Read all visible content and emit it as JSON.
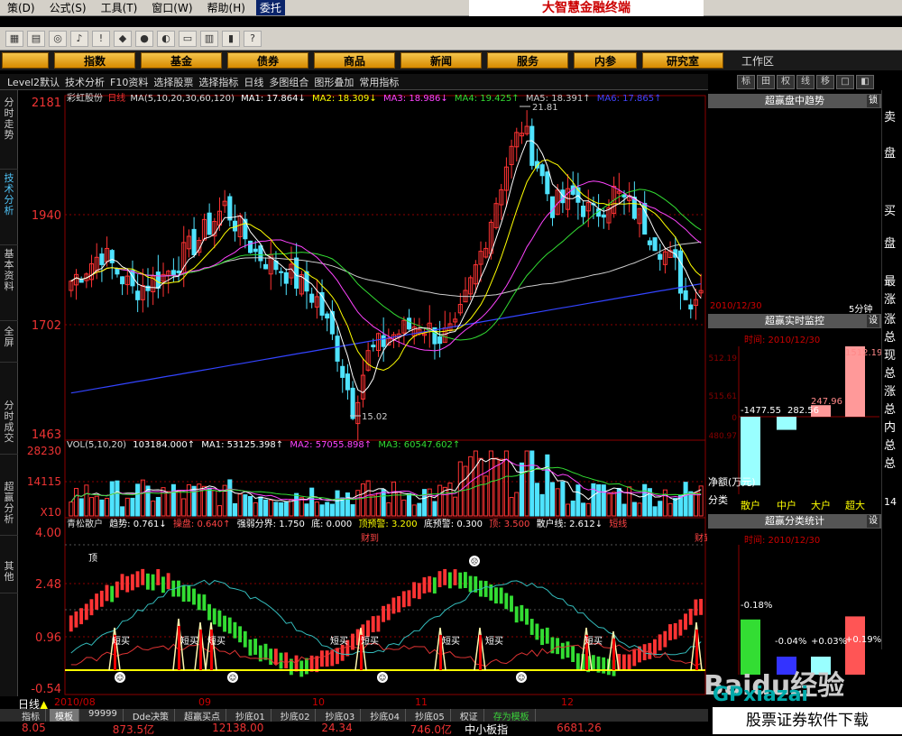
{
  "menu": {
    "items": [
      "策(D)",
      "公式(S)",
      "工具(T)",
      "窗口(W)",
      "帮助(H)"
    ],
    "trade": "委托"
  },
  "brand": "大智慧金融终端",
  "nav": {
    "buttons": [
      "指数",
      "基金",
      "债券",
      "商品",
      "新闻",
      "服务",
      "内参",
      "研究室"
    ],
    "workarea": "工作区"
  },
  "tabrow": [
    "Level2默认",
    "技术分析",
    "F10资料",
    "选择股票",
    "选择指标",
    "日线",
    "多图组合",
    "图形叠加",
    "常用指标"
  ],
  "right_tools": [
    "标",
    "田",
    "权",
    "线",
    "移",
    "□",
    "◧"
  ],
  "left_tabs": [
    "分时走势",
    "技术分析",
    "基本资料",
    "全屏",
    "分时成交",
    "超赢分析",
    "其他"
  ],
  "price_panel": {
    "stock_name": "彩虹股份",
    "period": "日线",
    "ma_label": "MA(5,10,20,30,60,120)",
    "ma_values": [
      "MA1: 17.864↓",
      "MA2: 18.309↓",
      "MA3: 18.986↓",
      "MA4: 19.425↑",
      "MA5: 18.391↑",
      "MA6: 17.865↑"
    ],
    "y_ticks": [
      "2181",
      "1940",
      "1702",
      "1463"
    ],
    "high_label": "21.81",
    "low_label": "15.02"
  },
  "vol_panel": {
    "label": "VOL(5,10,20)",
    "values": [
      "103184.000↑",
      "MA1: 53125.398↑",
      "MA2: 57055.898↑",
      "MA3: 60547.602↑"
    ],
    "y_ticks": [
      "28230",
      "14115",
      "X10"
    ]
  },
  "indicator_panel": {
    "title": "青松散户",
    "values": [
      "趋势: 0.761↓",
      "操盘: 0.640↑",
      "强弱分界: 1.750",
      "底: 0.000",
      "顶预警: 3.200",
      "底预警: 0.300",
      "顶: 3.500",
      "散户线: 2.612↓",
      "短线"
    ],
    "y_ticks": [
      "4.00",
      "2.48",
      "0.96",
      "-0.54"
    ],
    "signal_labels": [
      "顶",
      "短买",
      "短买",
      "短买",
      "短买",
      "短买",
      "短买",
      "短买",
      "短买",
      "财到",
      "财到"
    ]
  },
  "dates": [
    "2010/08",
    "09",
    "10",
    "11",
    "12"
  ],
  "day_tag": "日线",
  "bottom_tabs": [
    "指标",
    "模板",
    "99999",
    "Dde决策",
    "超赢买点",
    "抄底01",
    "抄底02",
    "抄底03",
    "抄底04",
    "抄底05",
    "权证",
    "存为模板"
  ],
  "status": [
    "8.05",
    "873.5亿",
    "12138.00",
    "24.34",
    "746.0亿",
    "中小板指",
    "6681.26"
  ],
  "right_panel": {
    "trend_title": "超赢盘中趋势",
    "lock": "锁",
    "trend_date": "2010/12/30",
    "trend_period": "5分钟",
    "monitor_title": "超赢实时监控",
    "set1": "设",
    "monitor_time": "时间: 2010/12/30",
    "monitor_y": [
      "512.19",
      "515.61",
      "0",
      "480.97"
    ],
    "monitor_bars": [
      {
        "label": "散户",
        "value": -1477.55
      },
      {
        "label": "中户",
        "value": -282.56
      },
      {
        "label": "大户",
        "value": 247.96
      },
      {
        "label": "超大",
        "value": 1512.19
      }
    ],
    "monitor_values": [
      "-1477.55",
      "282.56",
      "247.96",
      "1512.19"
    ],
    "net_label": "净额(万元)",
    "category_label": "分类",
    "stat_title": "超赢分类统计",
    "set2": "设",
    "stat_time": "时间: 2010/12/30",
    "stat_bars": [
      {
        "label": "-0.18%",
        "value": -0.18
      },
      {
        "label": "-0.04%",
        "value": -0.04
      },
      {
        "label": "+0.03%",
        "value": 0.03
      },
      {
        "label": "+0.19%",
        "value": 0.19
      }
    ]
  },
  "far_right": [
    "卖",
    "盘",
    "买",
    "盘",
    "最",
    "涨",
    "涨",
    "总",
    "现",
    "总",
    "涨",
    "总",
    "内",
    "总",
    "总",
    "14"
  ],
  "watermark": {
    "baidu": "Baidu经验",
    "site": "GPxiazai",
    "caption": "股票证券软件下载"
  },
  "colors": {
    "up": "#ff3333",
    "down": "#4fe3ff",
    "ma1": "#ffffff",
    "ma2": "#ffff00",
    "ma3": "#ff44ff",
    "ma4": "#33dd33",
    "ma5": "#cccccc",
    "ma6": "#3344ff"
  }
}
